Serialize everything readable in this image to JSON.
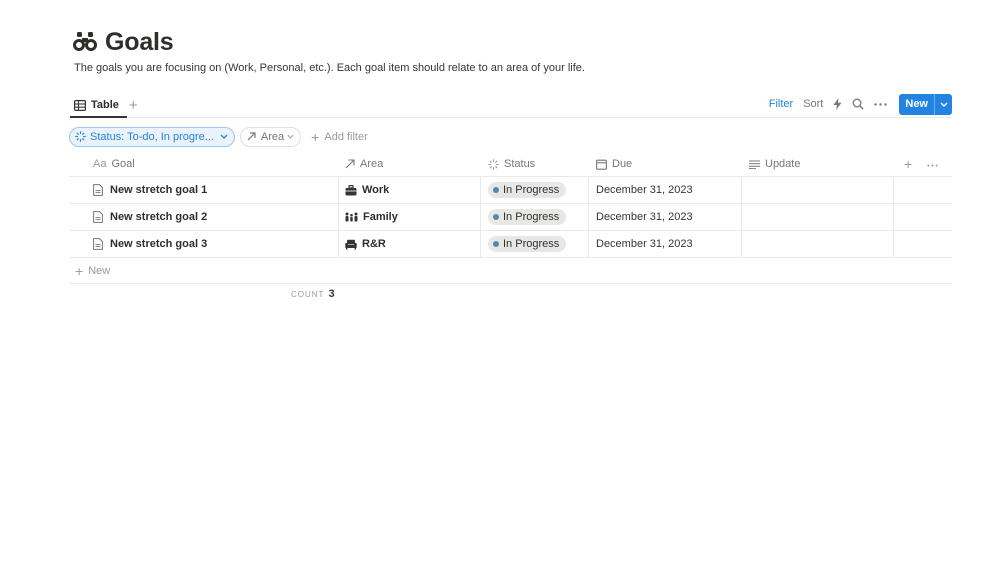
{
  "page": {
    "title": "Goals",
    "icon": "binoculars-icon",
    "description": "The goals you are focusing on (Work, Personal, etc.). Each goal item should relate to an area of your life."
  },
  "views": {
    "active_tab": "Table",
    "add_view": "+"
  },
  "toolbar": {
    "filter": "Filter",
    "sort": "Sort",
    "new": "New"
  },
  "filters": {
    "status_chip": "Status: To-do, In progre...",
    "area_chip": "Area",
    "add_filter": "Add filter"
  },
  "table": {
    "columns": [
      {
        "label": "Goal",
        "icon_text": "Aa"
      },
      {
        "label": "Area",
        "icon": "relation-arrow-icon"
      },
      {
        "label": "Status",
        "icon": "status-spinner-icon"
      },
      {
        "label": "Due",
        "icon": "calendar-icon"
      },
      {
        "label": "Update",
        "icon": "text-lines-icon"
      }
    ],
    "rows": [
      {
        "goal": "New stretch goal 1",
        "area": "Work",
        "area_icon": "briefcase-icon",
        "status": "In Progress",
        "due": "December 31, 2023",
        "update": ""
      },
      {
        "goal": "New stretch goal 2",
        "area": "Family",
        "area_icon": "family-icon",
        "status": "In Progress",
        "due": "December 31, 2023",
        "update": ""
      },
      {
        "goal": "New stretch goal 3",
        "area": "R&R",
        "area_icon": "couch-icon",
        "status": "In Progress",
        "due": "December 31, 2023",
        "update": ""
      }
    ],
    "new_row": "New",
    "count_label": "COUNT",
    "count_value": "3"
  },
  "colors": {
    "accent": "#2383e2",
    "status_dot": "#5786ab",
    "status_pill_bg": "#e7e7e5"
  }
}
